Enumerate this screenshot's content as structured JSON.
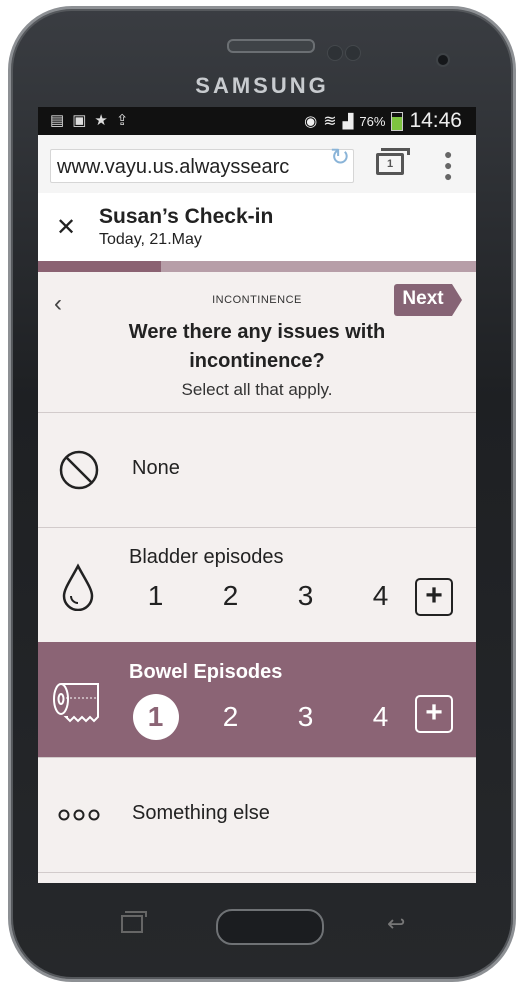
{
  "device": {
    "brand": "SAMSUNG"
  },
  "statusbar": {
    "battery_pct": "76%",
    "time": "14:46",
    "battery_level": 0.76
  },
  "browser": {
    "url": "www.vayu.us.alwayssearc",
    "tab_count": "1"
  },
  "header": {
    "title": "Susan’s Check-in",
    "subtitle": "Today, 21.May"
  },
  "progress": {
    "fraction": 0.28
  },
  "page": {
    "section": "INCONTINENCE",
    "next_label": "Next",
    "question": "Were there any issues with incontinence?",
    "hint": "Select all that apply."
  },
  "options": {
    "none": {
      "label": "None",
      "icon": "no-entry-icon"
    },
    "bladder": {
      "label": "Bladder episodes",
      "icon": "droplet-icon",
      "counts": [
        "1",
        "2",
        "3",
        "4"
      ],
      "plus": "+"
    },
    "bowel": {
      "label": "Bowel Episodes",
      "icon": "toilet-paper-icon",
      "counts": [
        "1",
        "2",
        "3",
        "4"
      ],
      "selected_count": "1",
      "plus": "+"
    },
    "else": {
      "label": "Something else",
      "icon": "more-icon"
    }
  },
  "colors": {
    "accent": "#8b6475",
    "progress_bg": "#b79ea8",
    "background": "#f4f0ef"
  }
}
